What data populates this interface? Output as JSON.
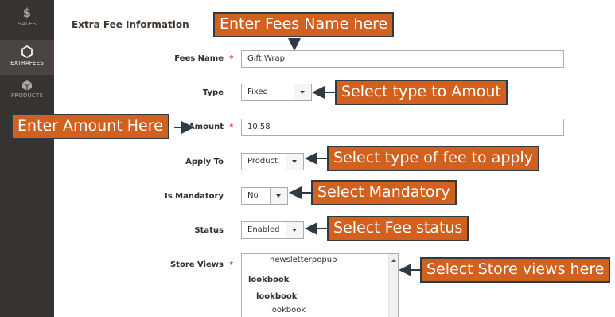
{
  "sidebar": {
    "items": [
      {
        "label": "SALES",
        "icon": "dollar-icon",
        "glyph": "$"
      },
      {
        "label": "EXTRAFEES",
        "icon": "hexagon-icon"
      },
      {
        "label": "PRODUCTS",
        "icon": "cube-icon"
      }
    ]
  },
  "section_title": "Extra Fee Information",
  "form": {
    "fees_name": {
      "label": "Fees Name",
      "value": "Gift Wrap",
      "required": "*"
    },
    "type": {
      "label": "Type",
      "value": "Fixed"
    },
    "amount": {
      "label": "Amount",
      "value": "10.58",
      "required": "*"
    },
    "apply_to": {
      "label": "Apply To",
      "value": "Product"
    },
    "is_mandatory": {
      "label": "Is Mandatory",
      "value": "No"
    },
    "status": {
      "label": "Status",
      "value": "Enabled"
    },
    "store_views": {
      "label": "Store Views",
      "required": "*",
      "options": [
        "newsletterpopup",
        "lookbook",
        "lookbook",
        "lookbook"
      ]
    }
  },
  "callouts": {
    "fees_name": "Enter Fees Name here",
    "type": "Select type to Amout",
    "amount": "Enter Amount Here",
    "apply_to": "Select type of fee to apply",
    "mandatory": "Select Mandatory",
    "status": "Select Fee status",
    "store_views": "Select Store views here"
  },
  "colors": {
    "callout_bg": "#d2601f",
    "callout_border": "#2f3b44",
    "sidebar_bg": "#373330",
    "required": "#e22626"
  }
}
